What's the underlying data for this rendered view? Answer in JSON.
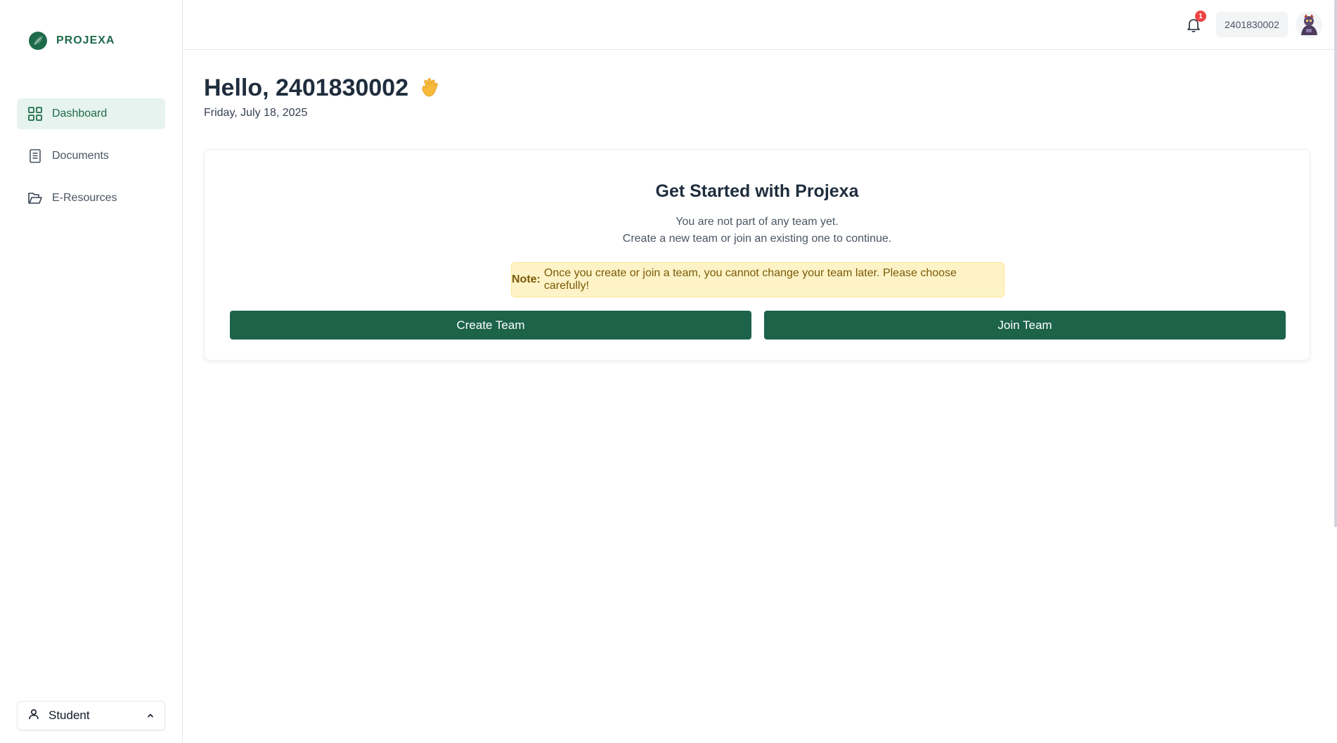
{
  "app": {
    "name": "PROJEXA"
  },
  "sidebar": {
    "items": [
      {
        "label": "Dashboard",
        "icon": "grid-icon",
        "active": true
      },
      {
        "label": "Documents",
        "icon": "document-icon",
        "active": false
      },
      {
        "label": "E-Resources",
        "icon": "folder-open-icon",
        "active": false
      }
    ],
    "role": {
      "label": "Student",
      "icon": "user-icon"
    }
  },
  "header": {
    "notification_count": "1",
    "user_id": "2401830002"
  },
  "main": {
    "greeting": "Hello, 2401830002",
    "date": "Friday, July 18, 2025",
    "card": {
      "title": "Get Started with Projexa",
      "line1": "You are not part of any team yet.",
      "line2": "Create a new team or join an existing one to continue.",
      "note_label": "Note:",
      "note_text": "Once you create or join a team, you cannot change your team later. Please choose carefully!",
      "create_label": "Create Team",
      "join_label": "Join Team"
    }
  },
  "colors": {
    "brand": "#1e6b4a",
    "button": "#1c634a",
    "active_bg": "#e6f3ee",
    "note_bg": "#fef3c7",
    "badge": "#ef4444"
  }
}
